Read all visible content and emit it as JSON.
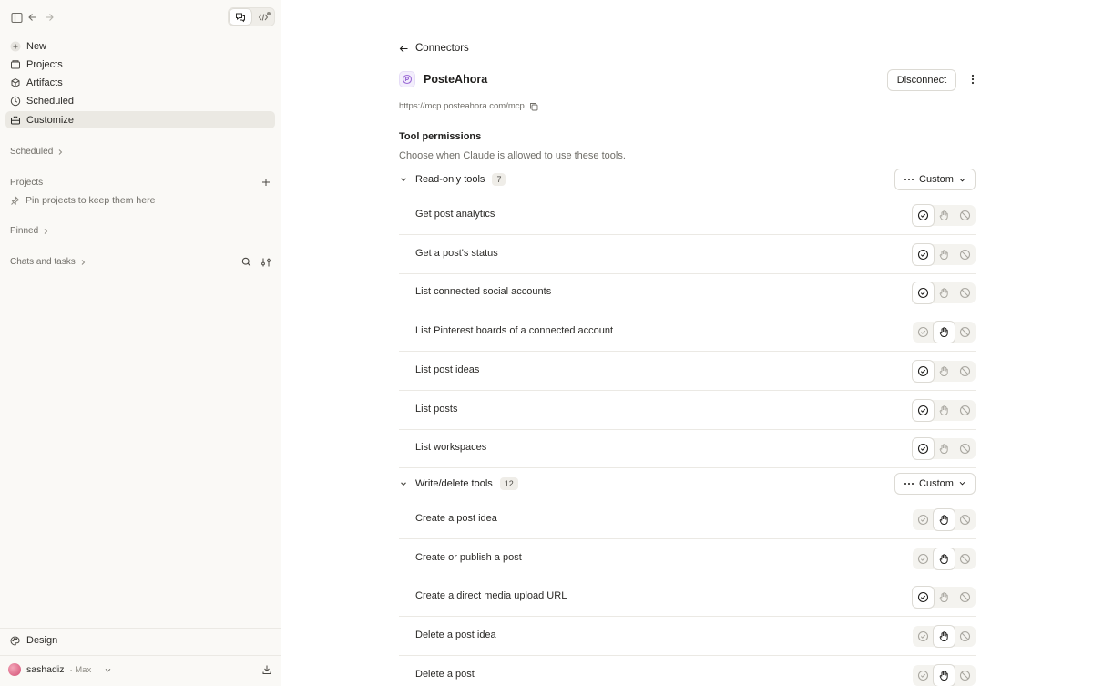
{
  "sidebar": {
    "nav": [
      {
        "label": "New",
        "icon": "plus-circle-icon"
      },
      {
        "label": "Projects",
        "icon": "folder-icon"
      },
      {
        "label": "Artifacts",
        "icon": "artifacts-icon"
      },
      {
        "label": "Scheduled",
        "icon": "clock-icon"
      },
      {
        "label": "Customize",
        "icon": "briefcase-icon",
        "active": true
      }
    ],
    "scheduled_label": "Scheduled",
    "projects_label": "Projects",
    "pin_hint": "Pin projects to keep them here",
    "pinned_label": "Pinned",
    "chats_label": "Chats and tasks",
    "design_label": "Design",
    "user": {
      "name": "sashadiz",
      "plan": "· Max"
    }
  },
  "header": {
    "back_label": "Connectors",
    "connector_name": "PosteAhora",
    "disconnect_label": "Disconnect",
    "url": "https://mcp.posteahora.com/mcp"
  },
  "permissions": {
    "title": "Tool permissions",
    "subtitle": "Choose when Claude is allowed to use these tools.",
    "groups": [
      {
        "label": "Read-only tools",
        "count": "7",
        "mode_label": "Custom",
        "tools": [
          {
            "name": "Get post analytics",
            "state": "allow"
          },
          {
            "name": "Get a post's status",
            "state": "allow"
          },
          {
            "name": "List connected social accounts",
            "state": "allow"
          },
          {
            "name": "List Pinterest boards of a connected account",
            "state": "ask"
          },
          {
            "name": "List post ideas",
            "state": "allow"
          },
          {
            "name": "List posts",
            "state": "allow"
          },
          {
            "name": "List workspaces",
            "state": "allow"
          }
        ]
      },
      {
        "label": "Write/delete tools",
        "count": "12",
        "mode_label": "Custom",
        "tools": [
          {
            "name": "Create a post idea",
            "state": "ask"
          },
          {
            "name": "Create or publish a post",
            "state": "ask"
          },
          {
            "name": "Create a direct media upload URL",
            "state": "allow"
          },
          {
            "name": "Delete a post idea",
            "state": "ask"
          },
          {
            "name": "Delete a post",
            "state": "ask"
          }
        ]
      }
    ]
  },
  "colors": {
    "accent_logo": "#9b6ad6",
    "active_nav": "#ebe9e3"
  }
}
